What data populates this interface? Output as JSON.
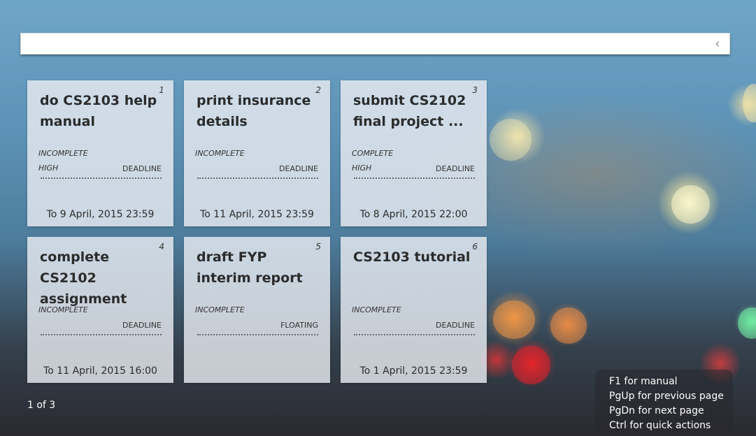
{
  "search": {
    "value": "",
    "placeholder": ""
  },
  "collapse_icon": "chevron-left-icon",
  "tasks": [
    {
      "number": "1",
      "title": "do CS2103 help manual",
      "status": "INCOMPLETE",
      "priority": "HIGH",
      "type": "DEADLINE",
      "date": "To 9 April, 2015 23:59"
    },
    {
      "number": "2",
      "title": "print insurance details",
      "status": "INCOMPLETE",
      "priority": "",
      "type": "DEADLINE",
      "date": "To 11 April, 2015 23:59"
    },
    {
      "number": "3",
      "title": "submit CS2102 final project ...",
      "status": "COMPLETE",
      "priority": "HIGH",
      "type": "DEADLINE",
      "date": "To 8 April, 2015 22:00"
    },
    {
      "number": "4",
      "title": "complete CS2102 assignment",
      "status": "INCOMPLETE",
      "priority": "",
      "type": "DEADLINE",
      "date": "To 11 April, 2015 16:00"
    },
    {
      "number": "5",
      "title": "draft FYP interim report",
      "status": "INCOMPLETE",
      "priority": "",
      "type": "FLOATING",
      "date": ""
    },
    {
      "number": "6",
      "title": "CS2103 tutorial",
      "status": "INCOMPLETE",
      "priority": "",
      "type": "DEADLINE",
      "date": "To 1 April, 2015 23:59"
    }
  ],
  "pagination": {
    "label": "1 of 3"
  },
  "help": [
    "F1 for manual",
    "PgUp for previous page",
    "PgDn for next page",
    "Ctrl for quick actions"
  ]
}
